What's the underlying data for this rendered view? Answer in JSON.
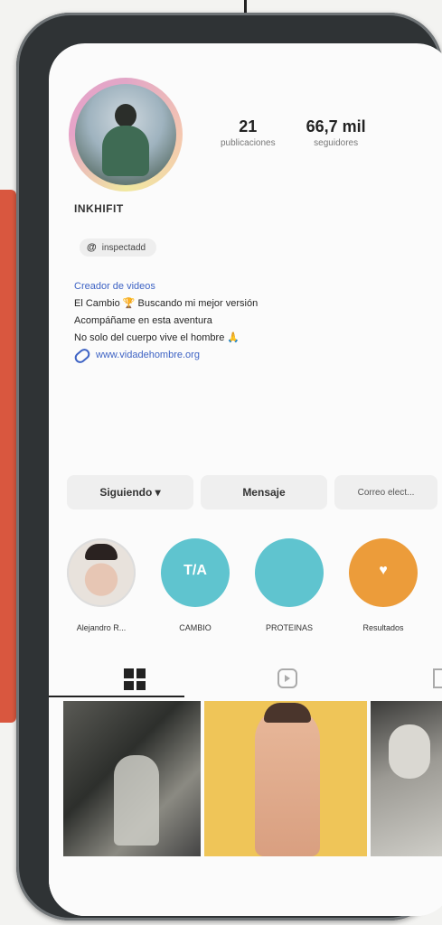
{
  "profile": {
    "username": "INKHIFIT",
    "stats": [
      {
        "value": "21",
        "label": "publicaciones"
      },
      {
        "value": "66,7 mil",
        "label": "seguidores"
      }
    ],
    "threads_chip": "inspectadd",
    "bio": {
      "category": "Creador de videos",
      "lines": [
        "El Cambio 🏆 Buscando mi mejor versión",
        "Acompáñame en esta aventura",
        "No solo del cuerpo vive el hombre 🙏"
      ],
      "link": "www.vidadehombre.org"
    }
  },
  "buttons": {
    "follow": "Siguiendo ▾",
    "message": "Mensaje",
    "contact": "Correo elect..."
  },
  "highlights": [
    {
      "label": "Alejandro R...",
      "glyph": ""
    },
    {
      "label": "CAMBIO",
      "glyph": "T/A"
    },
    {
      "label": "PROTEINAS",
      "glyph": ""
    },
    {
      "label": "Resultados",
      "glyph": "♥"
    }
  ],
  "colors": {
    "link_blue": "#3e63c4",
    "highlight_teal": "#5fc4cf",
    "highlight_orange": "#ec9c3a",
    "frame_accent": "#d9573f"
  },
  "tabs": [
    {
      "icon": "grid-icon",
      "active": true
    },
    {
      "icon": "reels-icon",
      "active": false
    },
    {
      "icon": "tagged-icon",
      "active": false
    }
  ]
}
